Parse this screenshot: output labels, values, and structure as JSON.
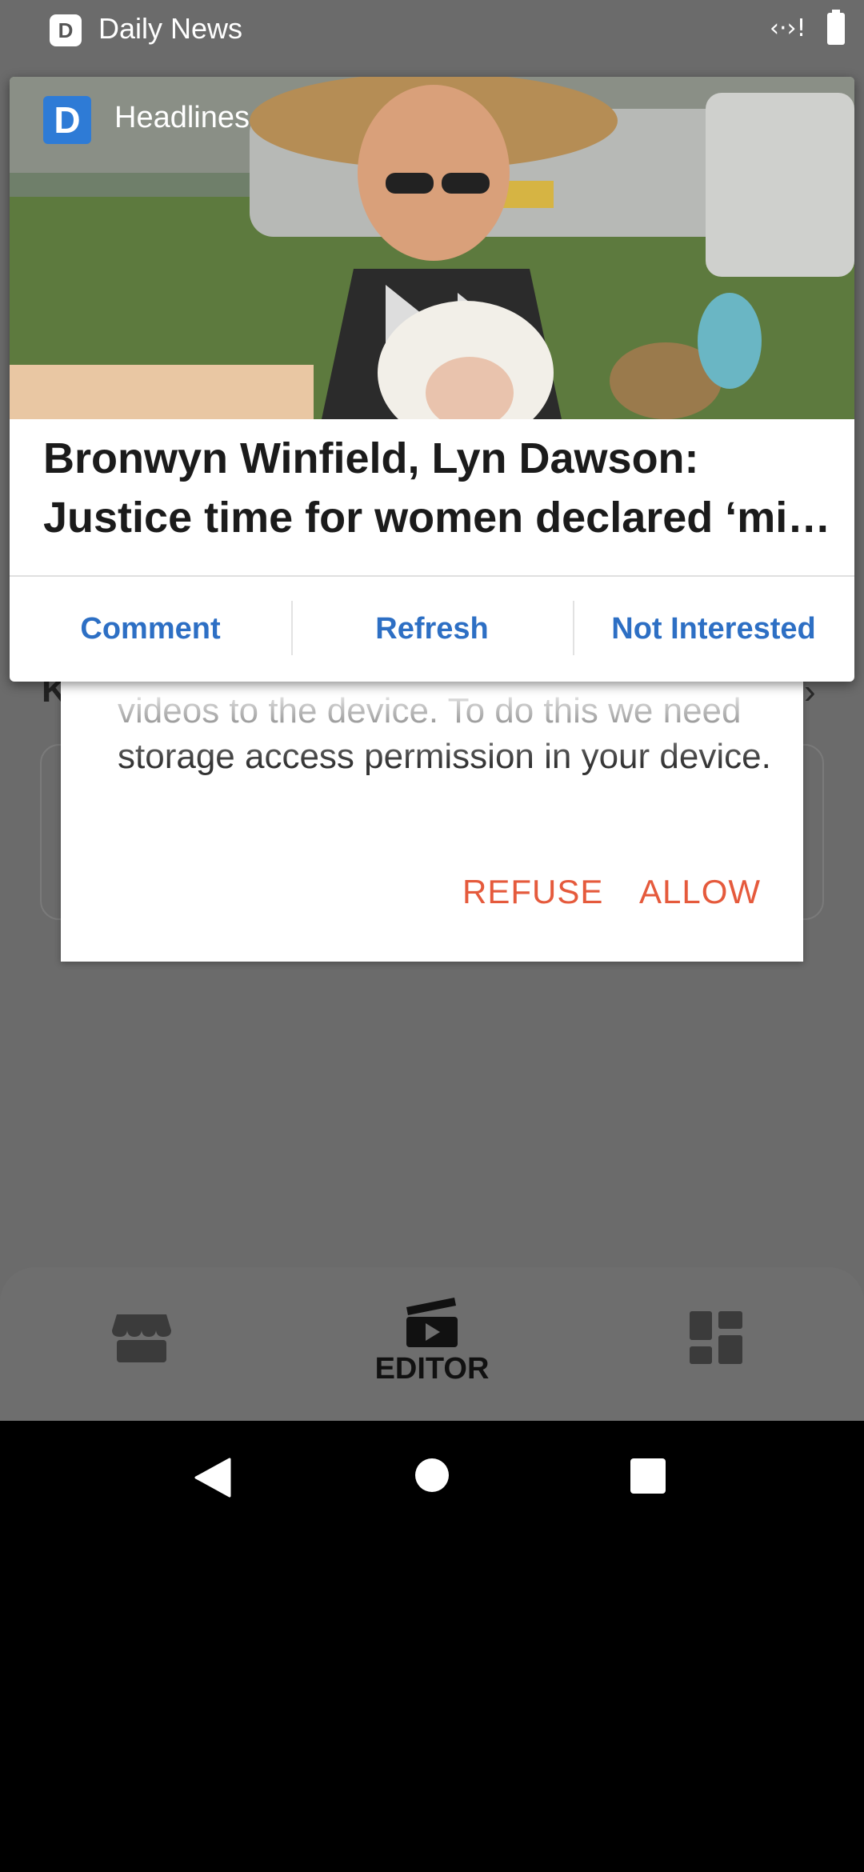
{
  "status_bar": {
    "app_name": "Daily News",
    "app_icon_letter": "D"
  },
  "notification": {
    "app_label": "Headlines",
    "app_icon_letter": "D",
    "image_description": "photo-woman-sunhat-with-baby",
    "title": "Bronwyn Winfield, Lyn Dawson: Justice time for women declared ‘mi…",
    "actions": [
      {
        "label": "Comment"
      },
      {
        "label": "Refresh"
      },
      {
        "label": "Not Interested"
      }
    ]
  },
  "background_app": {
    "partial_letter": "K",
    "chevron": "›"
  },
  "permission_dialog": {
    "message": "videos to the device. To do this we need storage access permission in your device.",
    "refuse_label": "REFUSE",
    "allow_label": "ALLOW"
  },
  "bottom_nav": {
    "items": [
      {
        "icon": "store-icon",
        "label": ""
      },
      {
        "icon": "clapperboard-icon",
        "label": "EDITOR"
      },
      {
        "icon": "dashboard-icon",
        "label": ""
      }
    ]
  },
  "colors": {
    "accent_blue": "#2d6fc4",
    "dialog_action": "#e55a3c",
    "app_background": "#6b6b6b"
  }
}
